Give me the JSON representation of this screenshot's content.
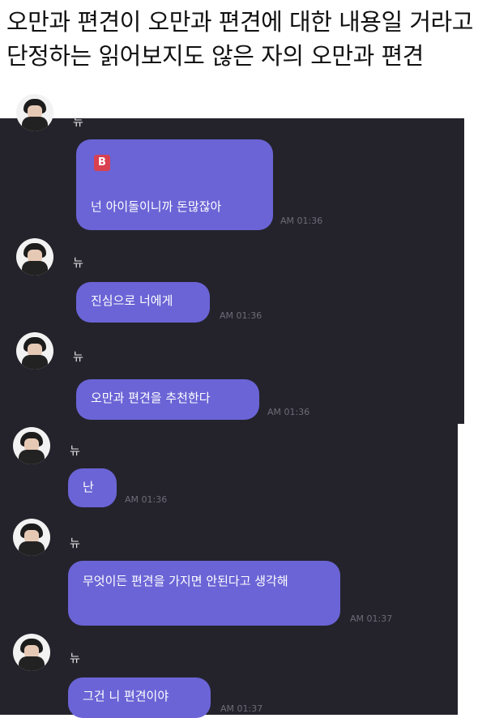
{
  "caption": {
    "text": "오만과 편견이 오만과 편견에 대한 내용일 거라고 단정하는 읽어보지도 않은 자의 오만과 편견"
  },
  "chat": {
    "top_partial": {
      "name": "뉴"
    },
    "messages": [
      {
        "sender": "",
        "badge": "B",
        "text": "넌 아이돌이니까 돈많잖아",
        "time": "AM 01:36"
      },
      {
        "sender": "뉴",
        "text": "진심으로 너에게",
        "time": "AM 01:36"
      },
      {
        "sender": "뉴",
        "text": "오만과 편견을 추천한다",
        "time": "AM 01:36"
      },
      {
        "sender": "뉴",
        "text": "난",
        "time": "AM 01:36"
      },
      {
        "sender": "뉴",
        "text": "무엇이든 편견을 가지면 안된다고 생각해",
        "time": "AM 01:37"
      },
      {
        "sender": "뉴",
        "text": "그건 니 편견이야",
        "time": "AM 01:37"
      }
    ]
  },
  "colors": {
    "bubble": "#6b64d6",
    "chat_bg": "#24232c",
    "badge": "#d94050"
  }
}
